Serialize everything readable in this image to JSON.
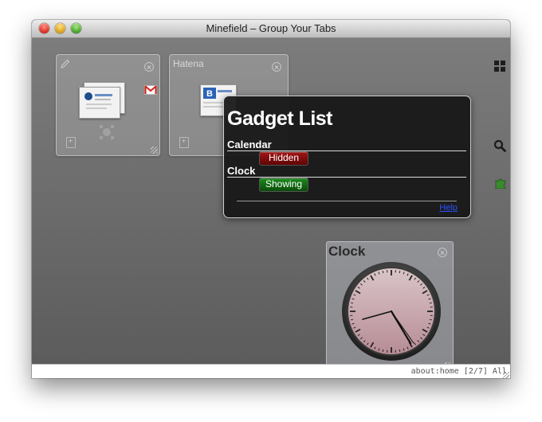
{
  "window": {
    "title": "Minefield – Group Your Tabs"
  },
  "status_bar": {
    "text": "about:home [2/7] All"
  },
  "tab_groups": [
    {
      "title": "",
      "thumbs": 2
    },
    {
      "title": "Hatena",
      "thumbs": 1
    }
  ],
  "gadget_list": {
    "title": "Gadget List",
    "items": [
      {
        "name": "Calendar",
        "state": "Hidden",
        "state_color": "#8b0e0e"
      },
      {
        "name": "Clock",
        "state": "Showing",
        "state_color": "#146a14"
      }
    ],
    "help_label": "Help"
  },
  "clock_widget": {
    "title": "Clock",
    "time": "4:52"
  },
  "icons": {
    "layout": "grid-icon",
    "search": "search-icon",
    "extensions": "puzzle-icon"
  },
  "colors": {
    "hidden_pill": "#8b0e0e",
    "showing_pill": "#146a14",
    "help_link": "#2b52ff"
  }
}
